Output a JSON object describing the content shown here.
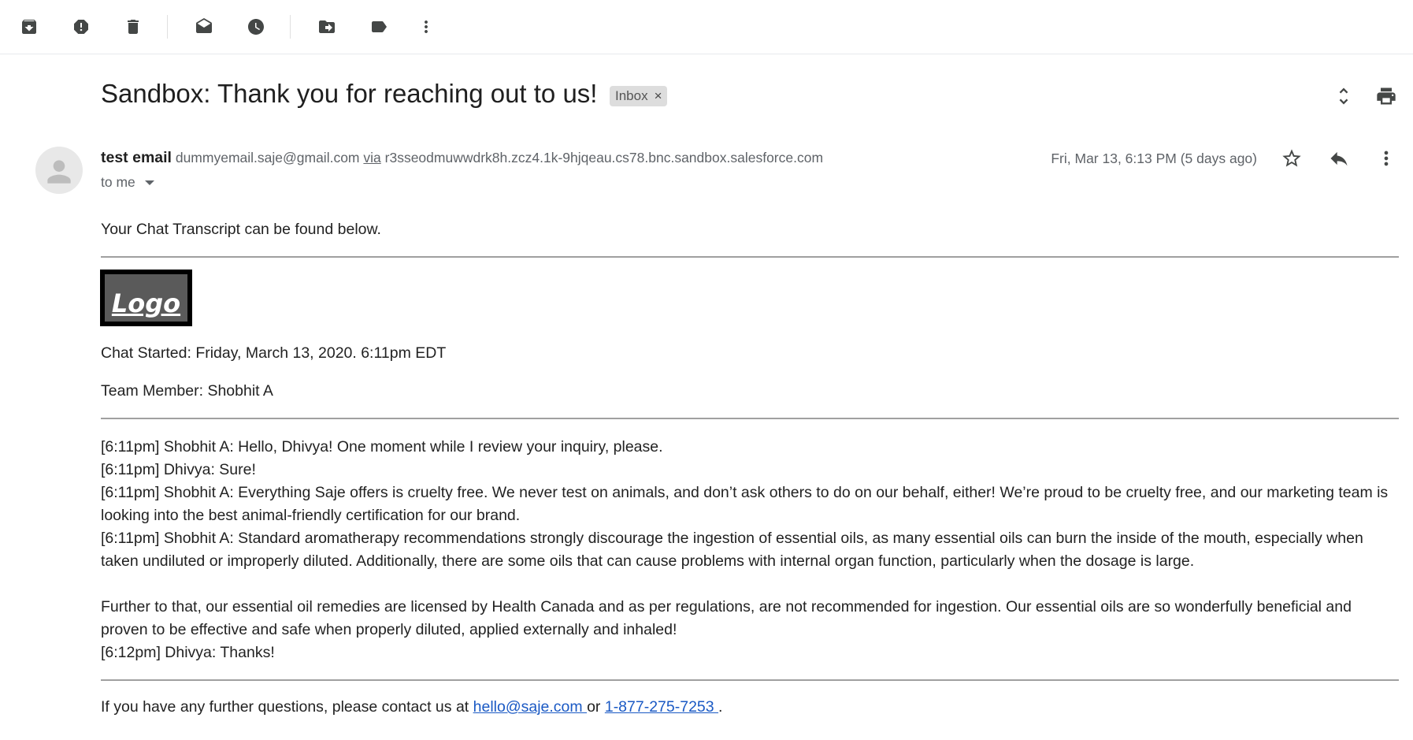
{
  "toolbar": {
    "buttons": [
      {
        "name": "archive-icon"
      },
      {
        "name": "report-spam-icon"
      },
      {
        "name": "delete-icon"
      },
      {
        "name": "mark-unread-icon"
      },
      {
        "name": "snooze-icon"
      },
      {
        "name": "move-to-icon"
      },
      {
        "name": "label-icon"
      },
      {
        "name": "more-vert-icon"
      }
    ]
  },
  "email": {
    "subject": "Sandbox: Thank you for reaching out to us!",
    "label": "Inbox",
    "label_close": "×",
    "sender_name": "test email",
    "sender_email": "dummyemail.saje@gmail.com",
    "via_label": "via",
    "via_domain": "r3sseodmuwwdrk8h.zcz4.1k-9hjqeau.cs78.bnc.sandbox.salesforce.com",
    "recipient": "to me",
    "date": "Fri, Mar 13, 6:13 PM (5 days ago)"
  },
  "body": {
    "intro": "Your Chat Transcript can be found below.",
    "logo_text": "Logo",
    "chat_started": "Chat Started: Friday, March 13, 2020. 6:11pm EDT",
    "team_member": "Team Member: Shobhit A",
    "transcript": [
      "[6:11pm] Shobhit A: Hello, Dhivya! One moment while I review your inquiry, please.",
      "[6:11pm] Dhivya: Sure!",
      "[6:11pm] Shobhit A: Everything Saje offers is cruelty free. We never test on animals, and don’t ask others to do on our behalf, either! We’re proud to be cruelty free, and our marketing team is looking into the best animal-friendly certification for our brand.",
      "[6:11pm] Shobhit A: Standard aromatherapy recommendations strongly discourage the ingestion of essential oils, as many essential oils can burn the inside of the mouth, especially when taken undiluted or improperly diluted. Additionally, there are some oils that can cause problems with internal organ function, particularly when the dosage is large.",
      "Further to that, our essential oil remedies are licensed by Health Canada and as per regulations, are not recommended for ingestion. Our essential oils are so wonderfully beneficial and proven to be effective and safe when properly diluted, applied externally and inhaled!",
      "[6:12pm] Dhivya: Thanks!"
    ],
    "footer_prefix": "If you have any further questions, please contact us at ",
    "footer_email": "hello@saje.com ",
    "footer_or": "or ",
    "footer_phone": "1-877-275-7253 ",
    "footer_suffix": "."
  },
  "colors": {
    "link": "#1a59c4",
    "icon": "#444746",
    "chip_bg": "#dddddd"
  }
}
